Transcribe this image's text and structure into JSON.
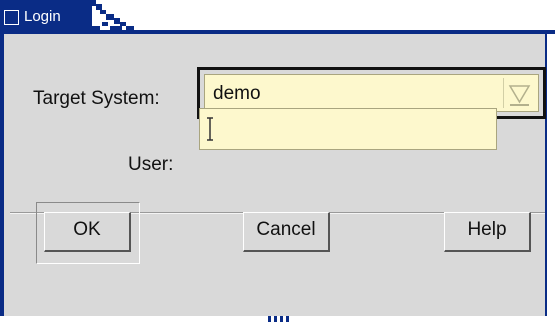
{
  "window": {
    "title": "Login"
  },
  "form": {
    "target_label": "Target System:",
    "target_value": "demo",
    "user_label": "User:",
    "user_value": ""
  },
  "buttons": {
    "ok": "OK",
    "cancel": "Cancel",
    "help": "Help"
  },
  "icons": {
    "window": "window-icon",
    "combo": "triangle-down-icon",
    "caret": "text-cursor-icon"
  },
  "colors": {
    "title_bar": "#0a2c86",
    "dialog_bg": "#d9d9d9",
    "field_bg": "#fdf8cd"
  }
}
